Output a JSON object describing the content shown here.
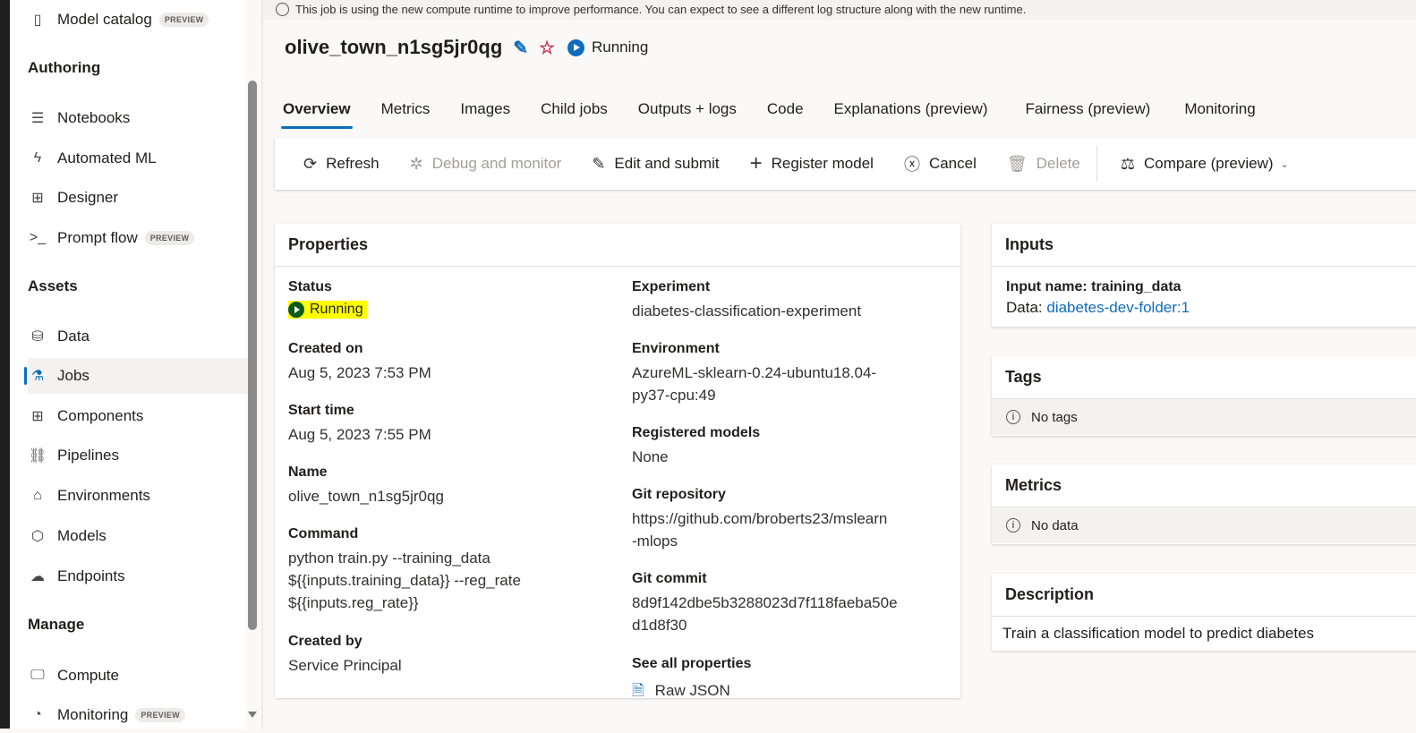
{
  "banner": {
    "text": "This job is using the new compute runtime to improve performance. You can expect to see a different log structure along with the new runtime."
  },
  "sidebar": {
    "model_catalog": {
      "label": "Model catalog",
      "badge": "PREVIEW"
    },
    "sections": {
      "authoring": "Authoring",
      "assets": "Assets",
      "manage": "Manage"
    },
    "authoring": [
      {
        "label": "Notebooks"
      },
      {
        "label": "Automated ML"
      },
      {
        "label": "Designer"
      },
      {
        "label": "Prompt flow",
        "badge": "PREVIEW"
      }
    ],
    "assets": [
      {
        "label": "Data"
      },
      {
        "label": "Jobs"
      },
      {
        "label": "Components"
      },
      {
        "label": "Pipelines"
      },
      {
        "label": "Environments"
      },
      {
        "label": "Models"
      },
      {
        "label": "Endpoints"
      }
    ],
    "manage": [
      {
        "label": "Compute"
      },
      {
        "label": "Monitoring",
        "badge": "PREVIEW"
      }
    ]
  },
  "header": {
    "title": "olive_town_n1sg5jr0qg",
    "status": "Running"
  },
  "tabs": [
    "Overview",
    "Metrics",
    "Images",
    "Child jobs",
    "Outputs + logs",
    "Code",
    "Explanations (preview)",
    "Fairness (preview)",
    "Monitoring"
  ],
  "toolbar": {
    "refresh": "Refresh",
    "debug": "Debug and monitor",
    "edit": "Edit and submit",
    "register": "Register model",
    "cancel": "Cancel",
    "delete": "Delete",
    "compare": "Compare (preview)"
  },
  "properties": {
    "title": "Properties",
    "status_label": "Status",
    "status": "Running",
    "created_on_label": "Created on",
    "created_on": "Aug 5, 2023 7:53 PM",
    "start_label": "Start time",
    "start": "Aug 5, 2023 7:55 PM",
    "name_label": "Name",
    "name": "olive_town_n1sg5jr0qg",
    "command_label": "Command",
    "command": [
      "python train.py --training_data",
      "${{inputs.training_data}} --reg_rate",
      "${{inputs.reg_rate}}"
    ],
    "created_by_label": "Created by",
    "created_by": "Service Principal",
    "experiment_label": "Experiment",
    "experiment": "diabetes-classification-experiment",
    "environment_label": "Environment",
    "environment": [
      "AzureML-sklearn-0.24-ubuntu18.04-",
      "py37-cpu:49"
    ],
    "registered_label": "Registered models",
    "registered": "None",
    "git_repo_label": "Git repository",
    "git_repo": [
      "https://github.com/broberts23/mslearn",
      "-mlops"
    ],
    "git_commit_label": "Git commit",
    "git_commit": [
      "8d9f142dbe5b3288023d7f118faeba50e",
      "d1d8f30"
    ],
    "see_all_label": "See all properties",
    "raw_json": "Raw JSON"
  },
  "inputs": {
    "title": "Inputs",
    "input_name": "Input name: training_data",
    "data_label": "Data: ",
    "data_value": "diabetes-dev-folder:1"
  },
  "tags": {
    "title": "Tags",
    "empty": "No tags"
  },
  "metrics": {
    "title": "Metrics",
    "empty": "No data"
  },
  "description": {
    "title": "Description",
    "text": "Train a classification model to predict diabetes"
  }
}
